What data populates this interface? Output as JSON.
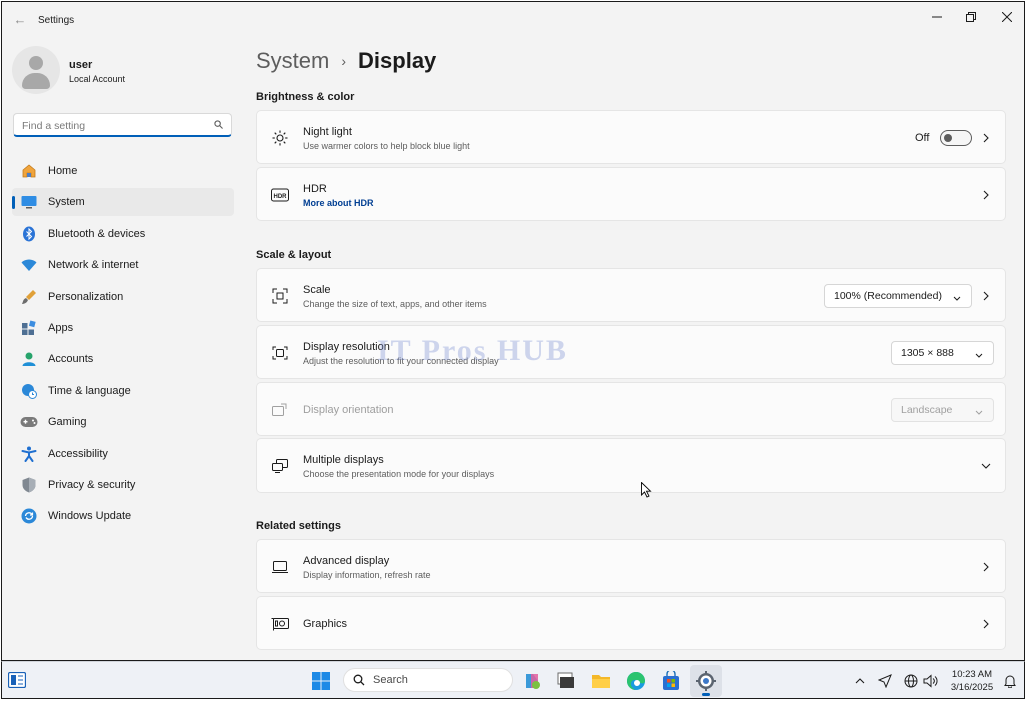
{
  "window": {
    "title": "Settings"
  },
  "profile": {
    "name": "user",
    "account": "Local Account"
  },
  "search": {
    "placeholder": "Find a setting"
  },
  "nav": {
    "items": [
      {
        "label": "Home",
        "icon": "home-icon"
      },
      {
        "label": "System",
        "icon": "system-icon",
        "active": true
      },
      {
        "label": "Bluetooth & devices",
        "icon": "bluetooth-icon"
      },
      {
        "label": "Network & internet",
        "icon": "wifi-icon"
      },
      {
        "label": "Personalization",
        "icon": "brush-icon"
      },
      {
        "label": "Apps",
        "icon": "apps-icon"
      },
      {
        "label": "Accounts",
        "icon": "accounts-icon"
      },
      {
        "label": "Time & language",
        "icon": "globe-clock-icon"
      },
      {
        "label": "Gaming",
        "icon": "gamepad-icon"
      },
      {
        "label": "Accessibility",
        "icon": "accessibility-icon"
      },
      {
        "label": "Privacy & security",
        "icon": "shield-icon"
      },
      {
        "label": "Windows Update",
        "icon": "update-icon"
      }
    ]
  },
  "breadcrumb": {
    "parent": "System",
    "separator": "›",
    "current": "Display"
  },
  "sections": {
    "brightness": "Brightness & color",
    "scale": "Scale & layout",
    "related": "Related settings"
  },
  "cards": {
    "night_light": {
      "title": "Night light",
      "subtitle": "Use warmer colors to help block blue light",
      "state": "Off"
    },
    "hdr": {
      "title": "HDR",
      "link": "More about HDR"
    },
    "scale": {
      "title": "Scale",
      "subtitle": "Change the size of text, apps, and other items",
      "value": "100% (Recommended)"
    },
    "resolution": {
      "title": "Display resolution",
      "subtitle": "Adjust the resolution to fit your connected display",
      "value": "1305 × 888"
    },
    "orientation": {
      "title": "Display orientation",
      "value": "Landscape"
    },
    "multiple": {
      "title": "Multiple displays",
      "subtitle": "Choose the presentation mode for your displays"
    },
    "advanced": {
      "title": "Advanced display",
      "subtitle": "Display information, refresh rate"
    },
    "graphics": {
      "title": "Graphics"
    }
  },
  "watermark": "IT Pros HUB",
  "taskbar": {
    "search_label": "Search",
    "time": "10:23 AM",
    "date": "3/16/2025"
  },
  "colors": {
    "accent": "#005fb8",
    "background": "#f3f3f3",
    "card": "#fbfbfb"
  }
}
